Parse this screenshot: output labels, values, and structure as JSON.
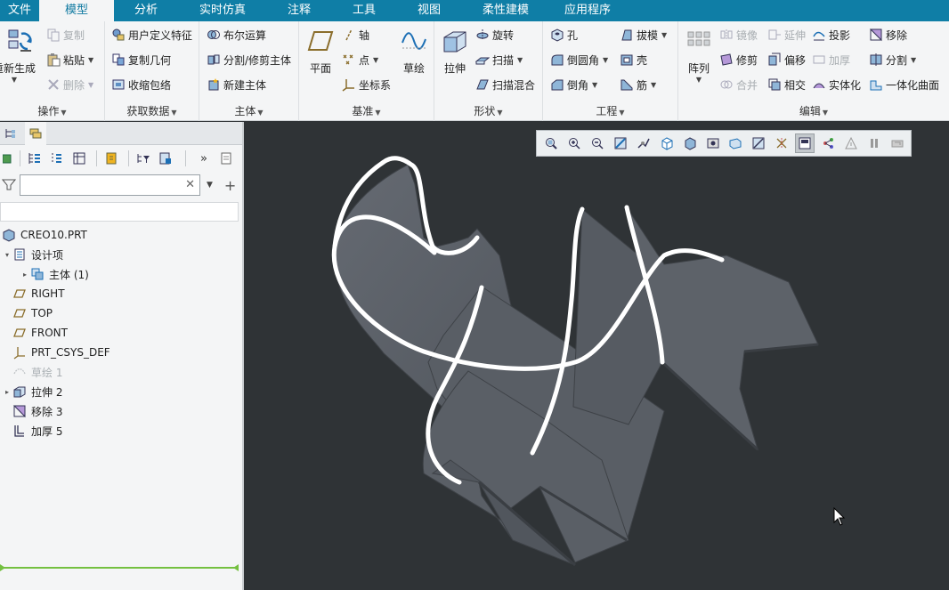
{
  "menu": {
    "tabs": [
      "文件",
      "模型",
      "分析",
      "实时仿真",
      "注释",
      "工具",
      "视图",
      "柔性建模",
      "应用程序"
    ],
    "active": "模型"
  },
  "ribbon": {
    "operations": {
      "label": "操作",
      "regenerate": "重新生成",
      "copy": "复制",
      "paste": "粘贴",
      "delete": "删除"
    },
    "get_data": {
      "label": "获取数据",
      "udf": "用户定义特征",
      "copy_geom": "复制几何",
      "shrinkwrap": "收缩包络"
    },
    "body": {
      "label": "主体",
      "boolean": "布尔运算",
      "split": "分割/修剪主体",
      "new_body": "新建主体"
    },
    "datum": {
      "label": "基准",
      "plane": "平面",
      "axis": "轴",
      "point": "点",
      "csys": "坐标系",
      "sketch": "草绘"
    },
    "shapes": {
      "label": "形状",
      "extrude": "拉伸",
      "revolve": "旋转",
      "sweep": "扫描",
      "swept_blend": "扫描混合"
    },
    "engineering": {
      "label": "工程",
      "hole": "孔",
      "round": "倒圆角",
      "chamfer": "倒角",
      "draft": "拔模",
      "shell": "壳",
      "rib": "筋"
    },
    "editing": {
      "label": "编辑",
      "pattern": "阵列",
      "mirror": "镜像",
      "trim": "修剪",
      "merge": "合并",
      "extend": "延伸",
      "offset": "偏移",
      "intersect": "相交",
      "project": "投影",
      "thicken": "加厚",
      "solidify": "实体化",
      "remove": "移除",
      "split": "分割",
      "unify": "一体化曲面"
    }
  },
  "tree": {
    "filter_placeholder": "",
    "nodes": [
      {
        "label": "CREO10.PRT",
        "icon": "part-icon",
        "indent": 0,
        "expander": ""
      },
      {
        "label": "设计项",
        "icon": "design-items-icon",
        "indent": 1,
        "expander": "▾"
      },
      {
        "label": "主体 (1)",
        "icon": "bodies-icon",
        "indent": 2,
        "expander": "▸"
      },
      {
        "label": "RIGHT",
        "icon": "datum-plane-icon",
        "indent": 1,
        "expander": ""
      },
      {
        "label": "TOP",
        "icon": "datum-plane-icon",
        "indent": 1,
        "expander": ""
      },
      {
        "label": "FRONT",
        "icon": "datum-plane-icon",
        "indent": 1,
        "expander": ""
      },
      {
        "label": "PRT_CSYS_DEF",
        "icon": "csys-icon",
        "indent": 1,
        "expander": ""
      },
      {
        "label": "草绘 1",
        "icon": "sketch-icon",
        "indent": 1,
        "expander": "",
        "dim": true
      },
      {
        "label": "拉伸 2",
        "icon": "extrude-icon",
        "indent": 1,
        "expander": "▸"
      },
      {
        "label": "移除 3",
        "icon": "remove-icon",
        "indent": 1,
        "expander": ""
      },
      {
        "label": "加厚 5",
        "icon": "thicken-icon",
        "indent": 1,
        "expander": ""
      }
    ]
  },
  "colors": {
    "menubar": "#0f7ea6",
    "ribbon": "#f4f5f6",
    "viewport": "#2f3336",
    "surface": "#5a5f66",
    "curve": "#ffffff",
    "insert_line": "#74c040"
  }
}
